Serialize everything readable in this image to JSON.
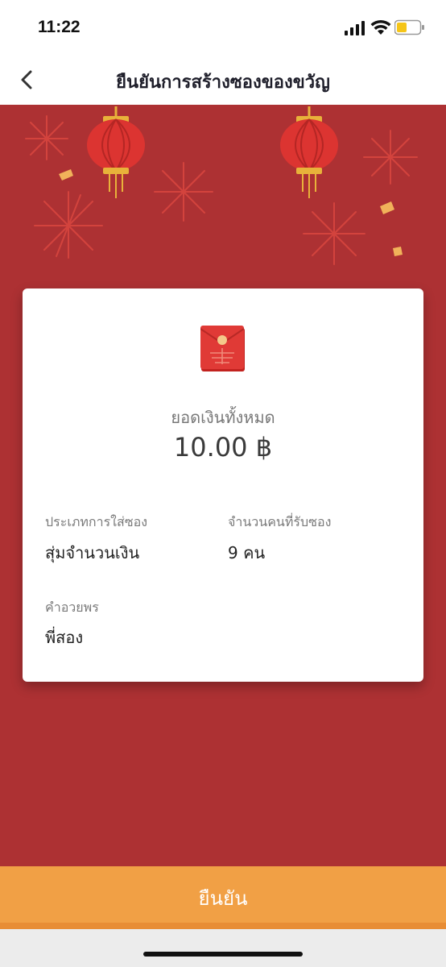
{
  "status_bar": {
    "time": "11:22"
  },
  "nav": {
    "title": "ยืนยันการสร้างซองของขวัญ"
  },
  "summary": {
    "total_label": "ยอดเงินทั้งหมด",
    "total_amount": "10.00 ฿"
  },
  "details": {
    "type_label": "ประเภทการใส่ซอง",
    "type_value": "สุ่มจำนวนเงิน",
    "recipients_label": "จำนวนคนที่รับซอง",
    "recipients_value": "9 คน",
    "blessing_label": "คำอวยพร",
    "blessing_value": "พี่สอง"
  },
  "actions": {
    "confirm_label": "ยืนยัน"
  },
  "colors": {
    "background_red": "#ad3133",
    "confirm_orange": "#f1a045",
    "envelope_red": "#e03a36",
    "battery_yellow": "#f5c518"
  }
}
